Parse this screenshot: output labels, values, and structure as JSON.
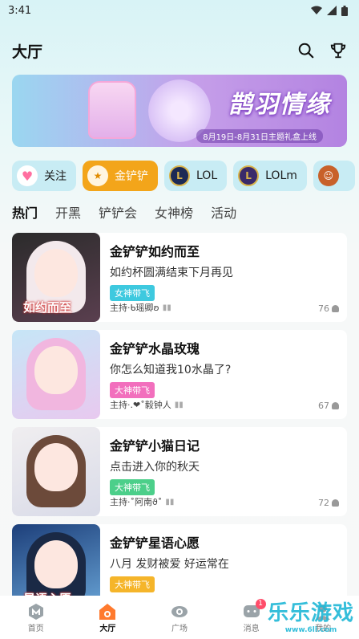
{
  "status_bar": {
    "time": "3:41"
  },
  "header": {
    "title": "大厅"
  },
  "banner": {
    "title": "鹊羽情缘",
    "subtitle": "8月19日-8月31日主题礼盒上线"
  },
  "categories": [
    {
      "label": "关注",
      "icon": "heart-icon"
    },
    {
      "label": "金铲铲",
      "icon": "golden-spatula-icon"
    },
    {
      "label": "LOL",
      "icon": "lol-icon"
    },
    {
      "label": "LOLm",
      "icon": "lolm-icon"
    },
    {
      "label": "",
      "icon": "game-hero-icon"
    }
  ],
  "tabs": [
    "热门",
    "开黑",
    "铲铲会",
    "女神榜",
    "活动"
  ],
  "rooms": [
    {
      "name": "金铲铲如约而至",
      "desc": "如约杯圆满结束下月再见",
      "badge": "女神带飞",
      "badge_color": "#3ec9df",
      "host": "主持·ᑲ瑶卿ʚ",
      "count": "76",
      "thumb_text": "如约而至"
    },
    {
      "name": "金铲铲水晶玫瑰",
      "desc": "你怎么知道我10水晶了?",
      "badge": "大神带飞",
      "badge_color": "#f26fbd",
      "host": "主持·.❤˚毅钟人",
      "count": "67",
      "thumb_text": ""
    },
    {
      "name": "金铲铲小猫日记",
      "desc": "点击进入你的秋天",
      "badge": "大神带飞",
      "badge_color": "#4ccf8a",
      "host": "主持·˚阿南ϑ˚",
      "count": "72",
      "thumb_text": ""
    },
    {
      "name": "金铲铲星语心愿",
      "desc": "八月 发财被爱 好运常在",
      "badge": "大神带飞",
      "badge_color": "#f5b52a",
      "host": "",
      "count": "",
      "thumb_text": "星语心愿"
    }
  ],
  "bottom_nav": [
    {
      "label": "首页",
      "icon": "home-icon"
    },
    {
      "label": "大厅",
      "icon": "hall-icon"
    },
    {
      "label": "广场",
      "icon": "plaza-icon"
    },
    {
      "label": "消息",
      "icon": "message-icon",
      "badge": "1"
    },
    {
      "label": "我的",
      "icon": "profile-icon"
    }
  ],
  "watermark": {
    "text": "乐乐游戏",
    "url": "www.6ll.com"
  },
  "colors": {
    "accent": "#f3a51a",
    "chip_bg": "#c8ecf4"
  }
}
